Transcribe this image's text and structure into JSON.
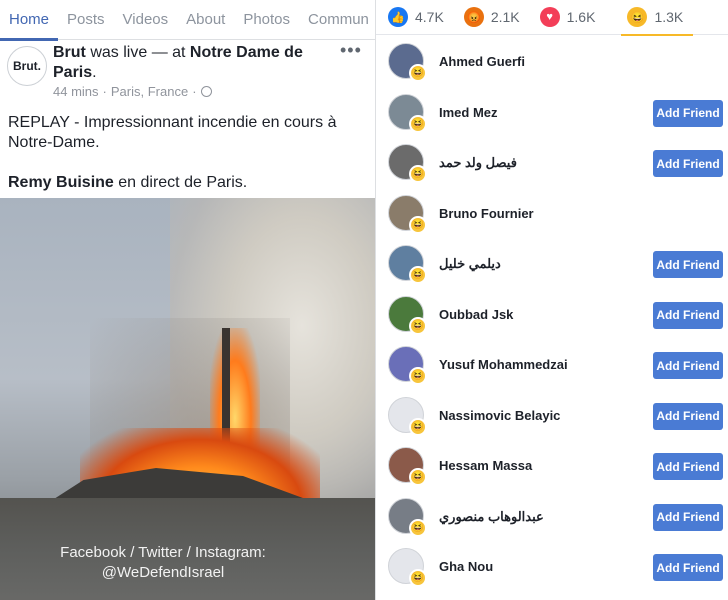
{
  "tabs": [
    "Home",
    "Posts",
    "Videos",
    "About",
    "Photos",
    "Commun"
  ],
  "post": {
    "page_avatar_text": "Brut.",
    "page_name": "Brut",
    "live_text": " was live — at ",
    "location_name": "Notre Dame de Paris",
    "location_suffix": ".",
    "time": "44 mins",
    "place": "Paris, France",
    "more": "•••",
    "text1": "REPLAY - Impressionnant incendie en cours à Notre-Dame.",
    "author": "Remy Buisine",
    "text2": " en direct de Paris.",
    "watermark_line1": "Facebook / Twitter / Instagram:",
    "watermark_line2": "@WeDefendIsrael"
  },
  "reactions": {
    "tabs": [
      {
        "icon": "like-icon",
        "count": "4.7K",
        "color": "#1877f2",
        "glyph": "👍"
      },
      {
        "icon": "angry-icon",
        "count": "2.1K",
        "color": "#e9710f",
        "glyph": "😡"
      },
      {
        "icon": "love-icon",
        "count": "1.6K",
        "color": "#f33e58",
        "glyph": "♥"
      },
      {
        "icon": "haha-icon",
        "count": "1.3K",
        "color": "#f7b928",
        "glyph": "😆"
      }
    ],
    "people": [
      {
        "name": "Ahmed Guerfi",
        "button": "",
        "avatar_color": "#5b6b8f"
      },
      {
        "name": "Imed Mez",
        "button": "Add Friend",
        "avatar_color": "#7c8a95"
      },
      {
        "name": "فيصل ولد حمد",
        "button": "Add Friend",
        "avatar_color": "#6b6b6b"
      },
      {
        "name": "Bruno Fournier",
        "button": "",
        "avatar_color": "#8a7c6a"
      },
      {
        "name": "ديلمي خليل",
        "button": "Add Friend",
        "avatar_color": "#5f7fa0"
      },
      {
        "name": "Oubbad Jsk",
        "button": "Add Friend",
        "avatar_color": "#4b7a3c"
      },
      {
        "name": "Yusuf Mohammedzai",
        "button": "Add Friend",
        "avatar_color": "#6a6fb8"
      },
      {
        "name": "Nassimovic Belayic",
        "button": "Add Friend",
        "avatar_color": "#e4e6eb"
      },
      {
        "name": "Hessam Massa",
        "button": "Add Friend",
        "avatar_color": "#8b5a4a"
      },
      {
        "name": "عبدالوهاب منصوري",
        "button": "Add Friend",
        "avatar_color": "#777d86"
      },
      {
        "name": "Gha Nou",
        "button": "Add Friend",
        "avatar_color": "#e4e6eb"
      }
    ]
  }
}
